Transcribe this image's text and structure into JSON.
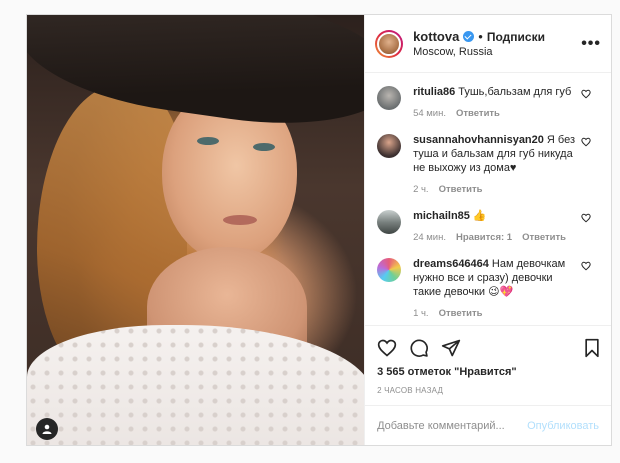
{
  "post": {
    "username": "kottova",
    "separator": "•",
    "follow_label": "Подписки",
    "location": "Moscow, Russia",
    "more_label": "•••",
    "verified": true
  },
  "comments": [
    {
      "user": "ritulia86",
      "text": "Тушь,бальзам для губ",
      "time": "54 мин.",
      "likes": "",
      "reply": "Ответить",
      "avatar_color": "#6b6f70"
    },
    {
      "user": "susannahovhannisyan20",
      "text": "Я без туша и бальзам для губ никуда не выхожу из дома♥",
      "time": "2 ч.",
      "likes": "",
      "reply": "Ответить",
      "avatar_color": "#3b2f2f"
    },
    {
      "user": "michailn85",
      "text": "👍",
      "time": "24 мин.",
      "likes": "Нравится: 1",
      "reply": "Ответить",
      "avatar_color": "#7a8280"
    },
    {
      "user": "dreams646464",
      "text": "Нам девочкам нужно все и сразу) девочки такие девочки 😉💖",
      "time": "1 ч.",
      "likes": "",
      "reply": "Ответить",
      "avatar_color": "#e65c7b"
    }
  ],
  "actions": {
    "likes_text": "3 565 отметок \"Нравится\"",
    "time_ago": "2 ЧАСОВ НАЗАД"
  },
  "add_comment": {
    "placeholder": "Добавьте комментарий...",
    "post_label": "Опубликовать"
  },
  "colors": {
    "verified": "#3897f0",
    "muted": "#8e8e8e",
    "post_disabled": "#b2dffc"
  }
}
